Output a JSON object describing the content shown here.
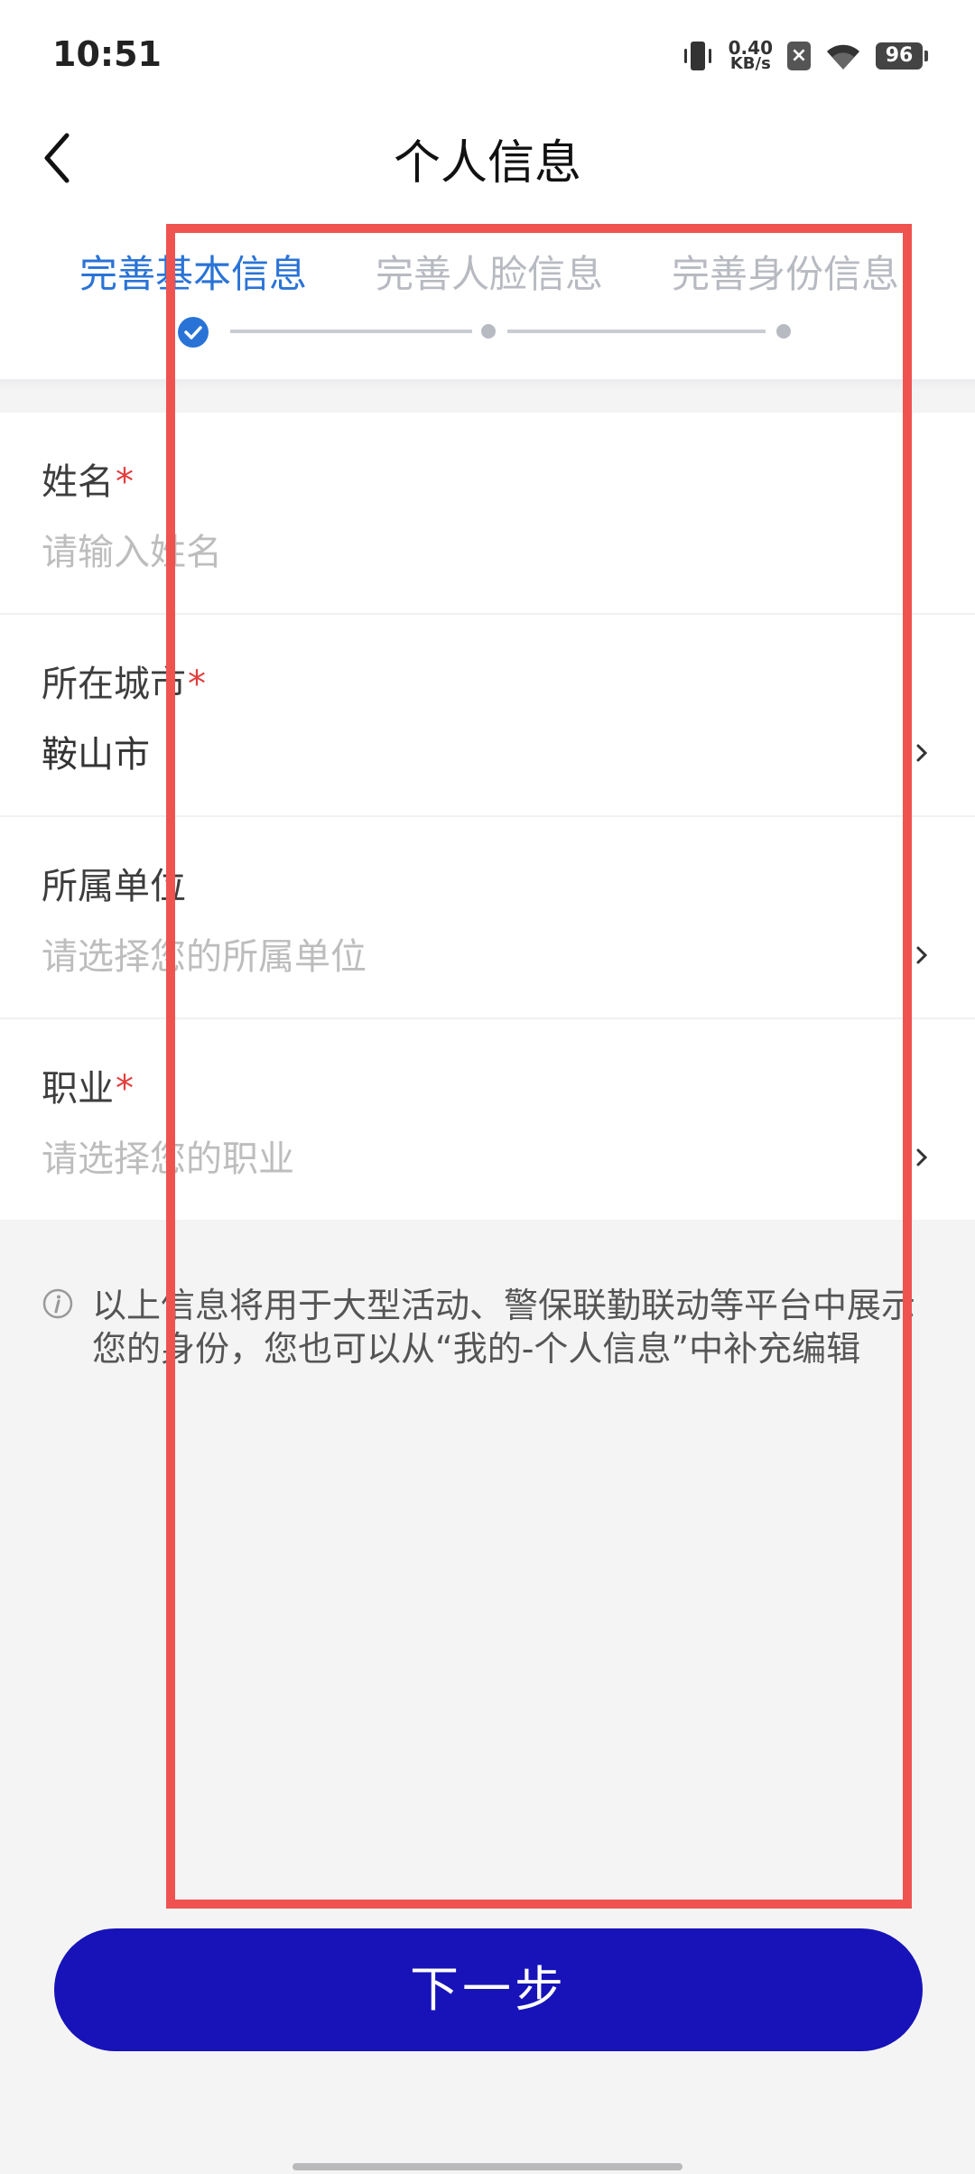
{
  "status_bar": {
    "time": "10:51",
    "net_speed_value": "0.40",
    "net_speed_unit": "KB/s",
    "sim_badge": "×",
    "battery": "96",
    "icons": [
      "vibrate-icon",
      "sim-off-icon",
      "wifi-icon",
      "battery-icon"
    ]
  },
  "header": {
    "title": "个人信息",
    "back_icon": "chevron-left-icon"
  },
  "stepper": {
    "steps": [
      {
        "label": "完善基本信息",
        "state": "done"
      },
      {
        "label": "完善人脸信息",
        "state": "pending"
      },
      {
        "label": "完善身份信息",
        "state": "pending"
      }
    ],
    "active_color": "#2a73d6",
    "inactive_color": "#b7bac1"
  },
  "form": {
    "fields": [
      {
        "label": "姓名",
        "required_mark": "*",
        "placeholder": "请输入姓名",
        "value": ""
      },
      {
        "label": "所在城市",
        "required_mark": "*",
        "placeholder": "",
        "value": "鞍山市"
      },
      {
        "label": "所属单位",
        "required_mark": "",
        "placeholder": "请选择您的所属单位",
        "value": ""
      },
      {
        "label": "职业",
        "required_mark": "*",
        "placeholder": "请选择您的职业",
        "value": ""
      }
    ]
  },
  "note": {
    "icon": "info-icon",
    "text": "以上信息将用于大型活动、警保联勤联动等平台中展示您的身份，您也可以从“我的-个人信息”中补充编辑"
  },
  "footer": {
    "next_label": "下一步",
    "button_color": "#1713b9"
  },
  "highlight_color": "#ef5350"
}
